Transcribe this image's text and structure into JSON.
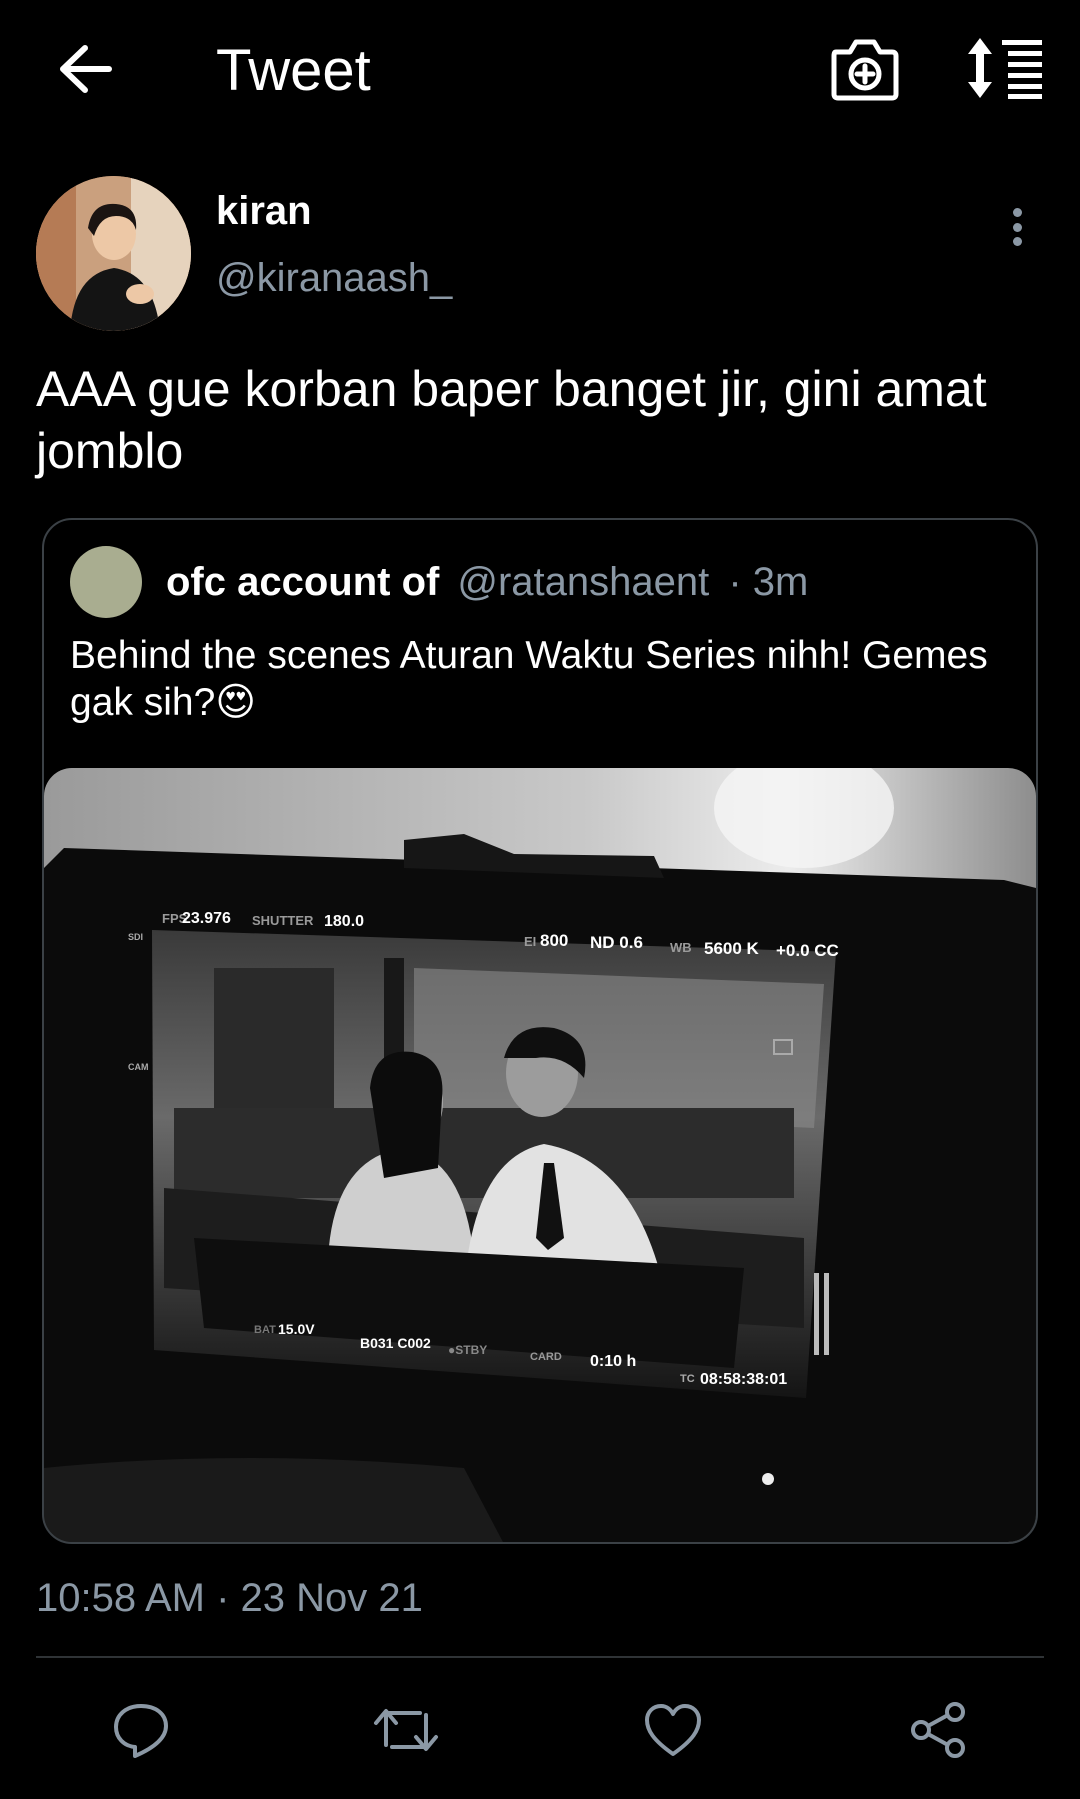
{
  "header": {
    "title": "Tweet",
    "back_icon": "arrow-left-icon",
    "camera_icon": "camera-plus-icon",
    "sort_icon": "sort-list-icon"
  },
  "tweet": {
    "author_name": "kiran",
    "author_handle": "@kiranaash_",
    "text": "AAA gue korban baper banget jir, gini amat jomblo",
    "timestamp": "10:58 AM · 23 Nov 21"
  },
  "quoted": {
    "name": "ofc account of",
    "handle": "@ratanshaent",
    "time": "· 3m",
    "text": "Behind the scenes Aturan Waktu Series nihh! Gemes gak sih?",
    "emoji": "😍",
    "media_overlay": {
      "fps_label": "FPS",
      "fps_value": "23.976",
      "shutter_label": "SHUTTER",
      "shutter_value": "180.0",
      "ei_label": "EI",
      "ei_value": "800",
      "nd_value": "ND 0.6",
      "wb_label": "WB",
      "wb_value": "5600 K",
      "cc_value": "+0.0 CC",
      "bat_label": "BAT",
      "bat_value": "15.0V",
      "clip_value": "B031 C002",
      "stby_label": "●STBY",
      "card_label": "CARD",
      "card_value": "0:10 h",
      "tc_label": "TC",
      "tc_value": "08:58:38:01",
      "sdi_label": "SDI",
      "cam_label": "CAM"
    }
  },
  "actions": {
    "reply_icon": "reply-bubble-icon",
    "retweet_icon": "retweet-icon",
    "like_icon": "heart-icon",
    "share_icon": "share-icon"
  },
  "colors": {
    "background": "#000000",
    "secondary_text": "#8b98a5",
    "border": "#3b4146"
  }
}
